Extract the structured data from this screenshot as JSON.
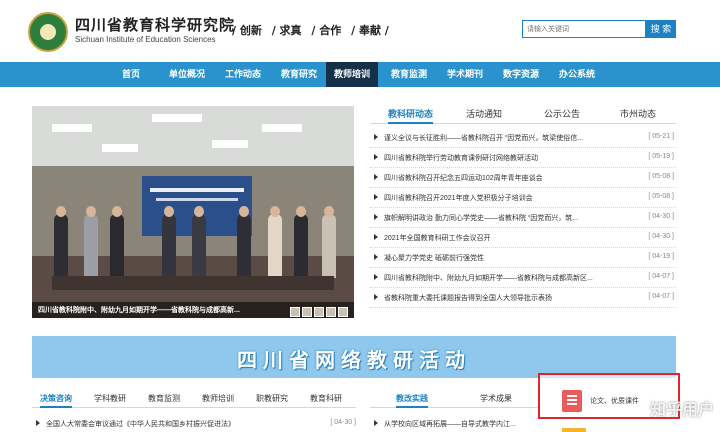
{
  "header": {
    "title_cn": "四川省教育科学研究院",
    "title_en": "Sichuan Institute of Education Sciences",
    "mottos": [
      "/ 创新",
      "/ 求真",
      "/ 合作",
      "/ 奉献 /"
    ],
    "search": {
      "placeholder": "请输入关键词",
      "button_label": "搜 索"
    }
  },
  "nav": {
    "items": [
      "首页",
      "单位概况",
      "工作动态",
      "教育研究",
      "教师培训",
      "教育监测",
      "学术期刊",
      "数字资源",
      "办公系统"
    ],
    "active": "教师培训"
  },
  "slideshow": {
    "caption": "四川省教科院附中、附幼九月如期开学——省教科院与成都高新...",
    "thumbnail_count": 5
  },
  "news": {
    "tabs": [
      "教科研动态",
      "活动通知",
      "公示公告",
      "市州动态"
    ],
    "active_tab": "教科研动态",
    "items": [
      {
        "title": "谨义全议与长征胜利——省教科院召开 “因党而兴，筑梁使俗信...",
        "date": "[ 05-21 ]"
      },
      {
        "title": "四川省教科院举行劳动教育课例研讨网络教研活动",
        "date": "[ 05-19 ]"
      },
      {
        "title": "四川省教科院召开纪念五四运动102周年青年座谈会",
        "date": "[ 05-08 ]"
      },
      {
        "title": "四川省教科院召开2021年度入党积极分子培训会",
        "date": "[ 05-08 ]"
      },
      {
        "title": "旗帜解明讲政治 勤力同心学党史——省教科院 “因党而兴，筑...",
        "date": "[ 04-30 ]"
      },
      {
        "title": "2021年全国教育科研工作会议召开",
        "date": "[ 04-30 ]"
      },
      {
        "title": "凝心聚力学党史 砥砺前行强党性",
        "date": "[ 04-19 ]"
      },
      {
        "title": "四川省教科院附中、附幼九月如期开学——省教科院与成都高新区...",
        "date": "[ 04-07 ]"
      },
      {
        "title": "省教科院重大委托课题报告得到全国人大领导批示表扬",
        "date": "[ 04-07 ]"
      }
    ]
  },
  "banner": {
    "text": "四川省网络教研活动"
  },
  "bottom_left": {
    "tabs": [
      "决策咨询",
      "学科教研",
      "教育监测",
      "教师培训",
      "职教研究",
      "教育科研"
    ],
    "active_tab": "决策咨询",
    "item": {
      "title": "全国人大常委会审议通过《中华人民共和国乡村振兴促进法》",
      "date": "[ 04-30 ]"
    }
  },
  "bottom_right": {
    "tabs": [
      "教改实践",
      "学术成果"
    ],
    "active_tab": "教改实践",
    "item": {
      "title": "从学校向区域再拓展——自导式教学内江..."
    }
  },
  "float_widget": {
    "label": "论文、优质课件"
  },
  "watermark": "知乎用户",
  "colors": {
    "nav_blue": "#2a93cd",
    "nav_active": "#16304a",
    "accent_blue": "#1d82c4",
    "popup_border": "#e0262b"
  }
}
